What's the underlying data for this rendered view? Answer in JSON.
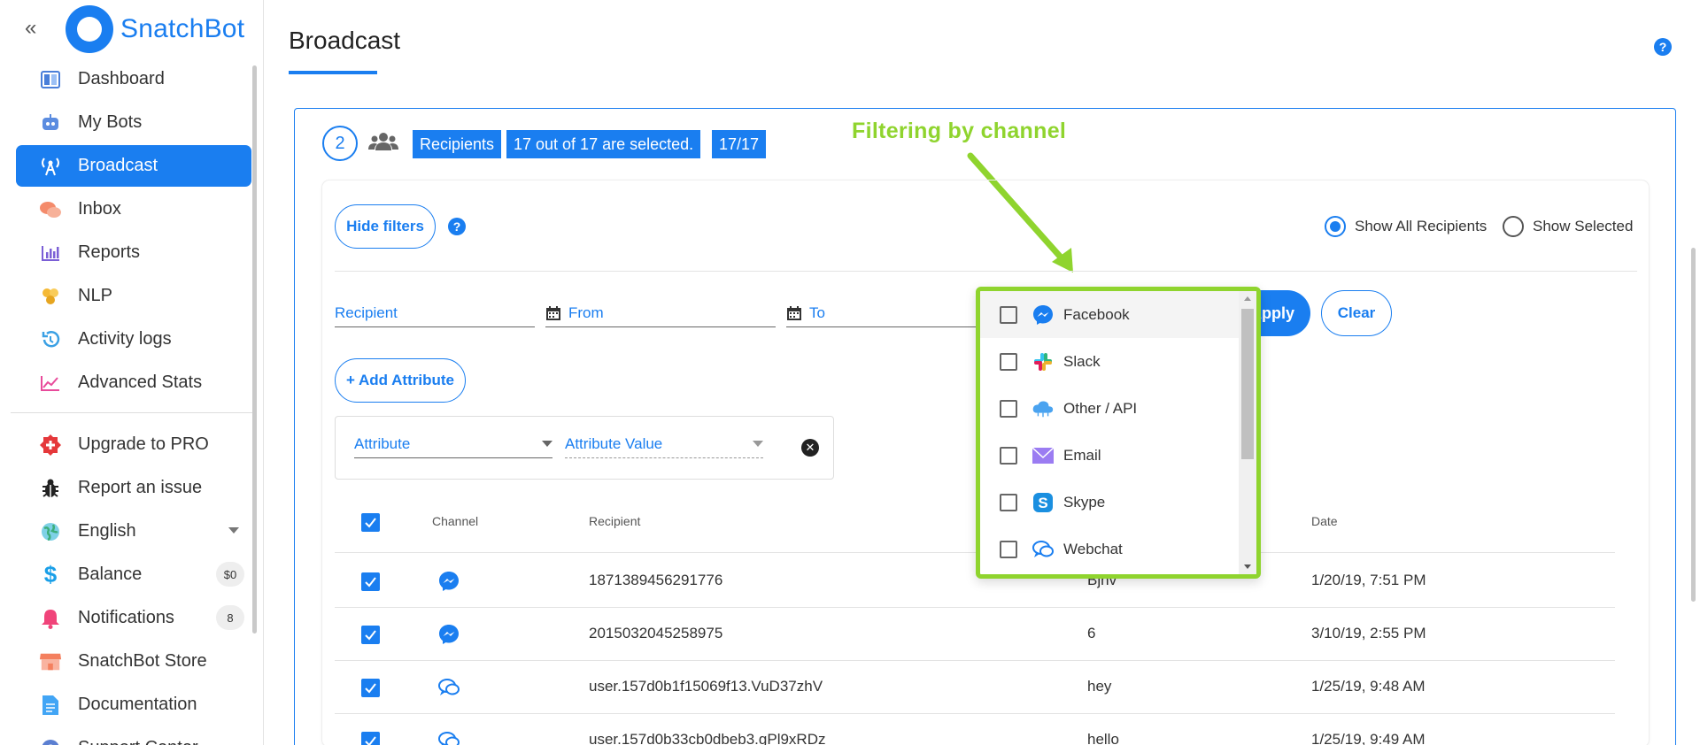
{
  "brand": {
    "name": "SnatchBot",
    "color": "#1a7ef0"
  },
  "sidebar": {
    "collapse_glyph": "«",
    "items": [
      {
        "label": "Dashboard",
        "icon": "dashboard-icon"
      },
      {
        "label": "My Bots",
        "icon": "bot-icon"
      },
      {
        "label": "Broadcast",
        "icon": "broadcast-icon",
        "active": true
      },
      {
        "label": "Inbox",
        "icon": "chat-bubbles-icon"
      },
      {
        "label": "Reports",
        "icon": "bar-chart-icon"
      },
      {
        "label": "NLP",
        "icon": "nlp-icon"
      },
      {
        "label": "Activity logs",
        "icon": "history-icon"
      },
      {
        "label": "Advanced Stats",
        "icon": "line-chart-icon"
      }
    ],
    "items2": [
      {
        "label": "Upgrade to PRO",
        "icon": "plus-badge-icon"
      },
      {
        "label": "Report an issue",
        "icon": "bug-icon"
      },
      {
        "label": "English",
        "icon": "globe-icon"
      },
      {
        "label": "Balance",
        "icon": "dollar-icon",
        "badge": "$0"
      },
      {
        "label": "Notifications",
        "icon": "bell-icon",
        "badge": "8"
      },
      {
        "label": "SnatchBot Store",
        "icon": "store-icon"
      },
      {
        "label": "Documentation",
        "icon": "document-icon"
      },
      {
        "label": "Support Center",
        "icon": "help-icon"
      }
    ]
  },
  "header": {
    "title": "Broadcast",
    "help": "?"
  },
  "step": {
    "number": "2",
    "tags": [
      "Recipients",
      "17 out of 17 are selected.",
      "17/17"
    ]
  },
  "annotation": {
    "text": "Filtering by channel",
    "color": "#8fd42e"
  },
  "filters": {
    "hide_filters_label": "Hide filters",
    "help": "?",
    "show_all_label": "Show All Recipients",
    "show_selected_label": "Show Selected",
    "show_all_selected": true,
    "recipient_placeholder": "Recipient",
    "from_placeholder": "From",
    "to_placeholder": "To",
    "apply_label": "Apply",
    "clear_label": "Clear",
    "add_attribute_label": "+ Add Attribute",
    "attribute_label": "Attribute",
    "attribute_value_label": "Attribute Value"
  },
  "channel_dropdown": {
    "options": [
      {
        "label": "Facebook",
        "icon": "messenger-icon",
        "checked": false
      },
      {
        "label": "Slack",
        "icon": "slack-icon",
        "checked": false
      },
      {
        "label": "Other / API",
        "icon": "cloud-icon",
        "checked": false
      },
      {
        "label": "Email",
        "icon": "email-icon",
        "checked": false
      },
      {
        "label": "Skype",
        "icon": "skype-icon",
        "checked": false
      },
      {
        "label": "Webchat",
        "icon": "webchat-icon",
        "checked": false
      }
    ]
  },
  "table": {
    "headers": {
      "channel": "Channel",
      "recipient": "Recipient",
      "date": "Date"
    },
    "rows": [
      {
        "channel": "messenger-icon",
        "recipient": "1871389456291776",
        "message": "Bjhv",
        "date": "1/20/19, 7:51 PM"
      },
      {
        "channel": "messenger-icon",
        "recipient": "2015032045258975",
        "message": "6",
        "date": "3/10/19, 2:55 PM"
      },
      {
        "channel": "webchat-icon",
        "recipient": "user.157d0b1f15069f13.VuD37zhV",
        "message": "hey",
        "date": "1/25/19, 9:48 AM"
      },
      {
        "channel": "webchat-icon",
        "recipient": "user.157d0b33cb0dbeb3.gPl9xRDz",
        "message": "hello",
        "date": "1/25/19, 9:49 AM"
      }
    ]
  }
}
